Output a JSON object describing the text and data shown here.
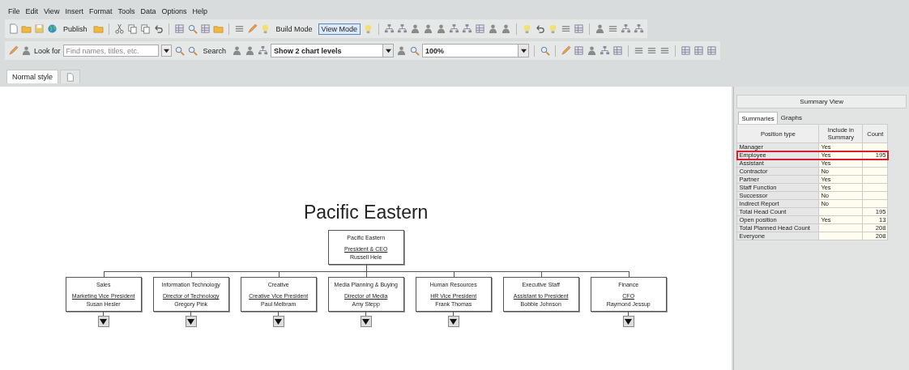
{
  "menu": [
    "File",
    "Edit",
    "View",
    "Insert",
    "Format",
    "Tools",
    "Data",
    "Options",
    "Help"
  ],
  "toolbar": {
    "publish": "Publish",
    "modes": [
      {
        "label": "Build Mode",
        "selected": false
      },
      {
        "label": "View Mode",
        "selected": true
      }
    ],
    "look_for": "Look for",
    "search_field": {
      "placeholder": "Find names, titles, etc."
    },
    "search": "Search",
    "chart_levels": "Show 2 chart levels",
    "zoom": "100%"
  },
  "tabs": [
    {
      "kind": "text",
      "label": "Normal style",
      "selected": true
    },
    {
      "kind": "icon",
      "selected": false
    }
  ],
  "chart": {
    "title": "Pacific Eastern",
    "root": {
      "department": "Pacific Eastern",
      "position": "President & CEO",
      "name": "Russell Hele"
    },
    "children": [
      {
        "department": "Sales",
        "position": "Marketing Vice President",
        "name": "Susan Hesler",
        "expandable": true
      },
      {
        "department": "Information Technology",
        "position": "Director of Technology",
        "name": "Gregory Pink",
        "expandable": true
      },
      {
        "department": "Creative",
        "position": "Creative Vice President",
        "name": "Paul Melbram",
        "expandable": true
      },
      {
        "department": "Media Planning & Buying",
        "position": "Director of Media",
        "name": "Amy Stepp",
        "expandable": true
      },
      {
        "department": "Human Resources",
        "position": "HR Vice President",
        "name": "Frank Thomas",
        "expandable": true
      },
      {
        "department": "Executive Staff",
        "position": "Assistant to President",
        "name": "Bobbie Johnson",
        "expandable": false
      },
      {
        "department": "Finance",
        "position": "CFO",
        "name": "Raymond Jessup",
        "expandable": true
      }
    ]
  },
  "summary": {
    "title": "Summary View",
    "tabs": [
      {
        "label": "Summaries",
        "selected": true
      },
      {
        "label": "Graphs",
        "selected": false
      }
    ],
    "columns": [
      "Position type",
      "Include in Summary",
      "Count"
    ],
    "rows": [
      {
        "type": "Manager",
        "include": "Yes",
        "count": "",
        "highlighted": false
      },
      {
        "type": "Employee",
        "include": "Yes",
        "count": "195",
        "highlighted": true
      },
      {
        "type": "Assistant",
        "include": "Yes",
        "count": "",
        "highlighted": false
      },
      {
        "type": "Contractor",
        "include": "No",
        "count": "",
        "highlighted": false
      },
      {
        "type": "Partner",
        "include": "Yes",
        "count": "",
        "highlighted": false
      },
      {
        "type": "Staff Function",
        "include": "Yes",
        "count": "",
        "highlighted": false
      },
      {
        "type": "Successor",
        "include": "No",
        "count": "",
        "highlighted": false
      },
      {
        "type": "Indirect Report",
        "include": "No",
        "count": "",
        "highlighted": false
      },
      {
        "type": "Total Head Count",
        "include": "",
        "count": "195",
        "highlighted": false
      },
      {
        "type": "Open position",
        "include": "Yes",
        "count": "13",
        "highlighted": false
      },
      {
        "type": "Total Planned Head Count",
        "include": "",
        "count": "208",
        "highlighted": false
      },
      {
        "type": "Everyone",
        "include": "",
        "count": "208",
        "highlighted": false
      }
    ]
  }
}
